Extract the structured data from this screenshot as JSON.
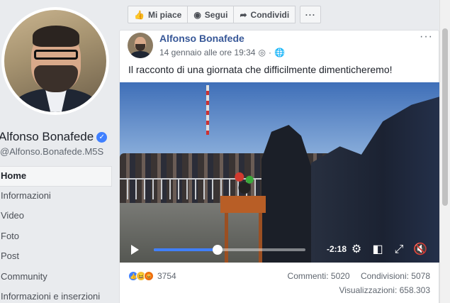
{
  "profile": {
    "name": "Alfonso Bonafede",
    "verified_icon": "verified-badge-icon",
    "username": "@Alfonso.Bonafede.M5S"
  },
  "sidebar": {
    "items": [
      {
        "label": "Home",
        "active": true
      },
      {
        "label": "Informazioni",
        "active": false
      },
      {
        "label": "Video",
        "active": false
      },
      {
        "label": "Foto",
        "active": false
      },
      {
        "label": "Post",
        "active": false
      },
      {
        "label": "Community",
        "active": false
      },
      {
        "label": "Informazioni e inserzioni",
        "active": false
      }
    ]
  },
  "actionbar": {
    "like": "Mi piace",
    "follow": "Segui",
    "share": "Condividi",
    "more": "···"
  },
  "post": {
    "author": "Alfonso Bonafede",
    "timestamp": "14 gennaio alle ore 19:34",
    "meta_sep": "·",
    "more": "···",
    "text": "Il racconto di una giornata che difficilmente dimenticheremo!"
  },
  "video": {
    "progress": 0.42,
    "time_remaining": "-2:18"
  },
  "footer": {
    "reaction_count": "3754",
    "comments": "Commenti: 5020",
    "shares": "Condivisioni: 5078",
    "views": "Visualizzazioni: 658.303"
  },
  "colors": {
    "link": "#385898",
    "accent": "#4080ff",
    "background": "#e9ebee"
  }
}
